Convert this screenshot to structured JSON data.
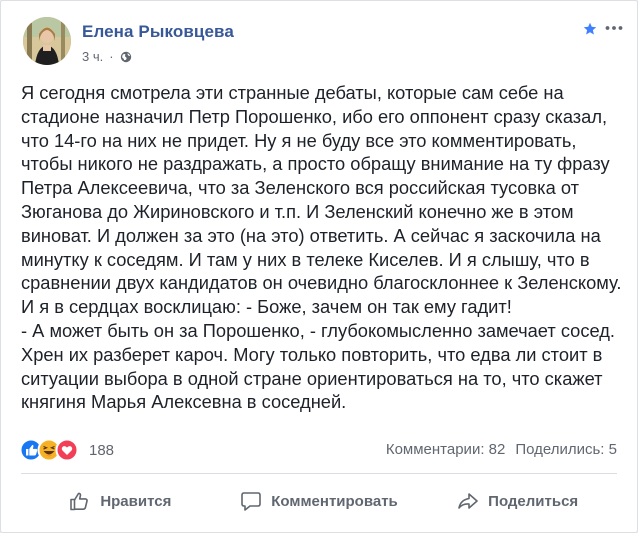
{
  "post": {
    "author": "Елена Рыковцева",
    "time": "3 ч.",
    "dot": "·",
    "icons": {
      "audience": "globe-icon",
      "favorite": "star-icon",
      "menu": "chevron-down-icon"
    },
    "paragraphs": [
      "Я сегодня смотрела эти странные дебаты, которые сам себе на стадионе назначил Петр Порошенко, ибо его оппонент сразу сказал, что 14-го на них не придет. Ну я не буду все это комментировать, чтобы никого не раздражать, а просто обращу внимание на ту фразу Петра Алексеевича, что за Зеленского вся российская тусовка от Зюганова до Жириновского и т.п. И Зеленский конечно же в этом виноват. И должен за это (на это) ответить. А сейчас я заскочила на минутку к соседям. И там у них в телеке Киселев. И я слышу, что в сравнении двух кандидатов он очевидно благосклоннее к Зеленскому. И я в сердцах восклицаю: - Боже, зачем он так ему гадит!",
      "- А может быть он за Порошенко, - глубокомысленно замечает сосед. Хрен их разберет кароч. Могу только повторить, что едва ли стоит в ситуации выбора в одной стране ориентироваться на то, что скажет княгиня Марья Алексевна в соседней."
    ]
  },
  "reactions": {
    "icons": [
      "like-reaction-icon",
      "haha-reaction-icon",
      "love-reaction-icon"
    ],
    "count": "188"
  },
  "stats": {
    "comments": "Комментарии: 82",
    "shares": "Поделились: 5"
  },
  "actions": {
    "like": "Нравится",
    "comment": "Комментировать",
    "share": "Поделиться"
  },
  "colors": {
    "author": "#385898",
    "like": "#1877f2",
    "love": "#f33e58",
    "haha": "#f7b125"
  }
}
